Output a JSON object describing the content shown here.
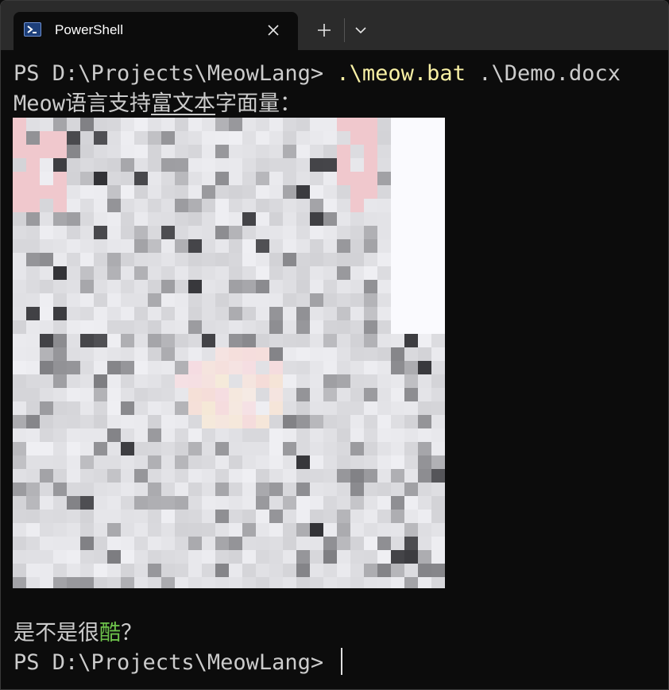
{
  "tab": {
    "title": "PowerShell",
    "icon": "powershell-icon",
    "close_icon": "close-icon"
  },
  "titlebar": {
    "new_tab_icon": "plus-icon",
    "dropdown_icon": "chevron-down-icon"
  },
  "terminal": {
    "line1": {
      "prompt": "PS D:\\Projects\\MeowLang> ",
      "command": ".\\meow.bat",
      "argument": " .\\Demo.docx"
    },
    "line2": {
      "prefix": "Meow语言支持",
      "underlined": "富文本",
      "suffix": "字面量："
    },
    "image_description": "pixelated anime character image",
    "line3": {
      "prefix": "是不是很",
      "highlight": "酷",
      "suffix": "？"
    },
    "line4": {
      "prompt": "PS D:\\Projects\\MeowLang> "
    }
  },
  "colors": {
    "background": "#0c0c0c",
    "titlebar": "#2b2b2b",
    "text": "#cccccc",
    "command": "#f9f1a5",
    "highlight": "#6cc04a"
  }
}
